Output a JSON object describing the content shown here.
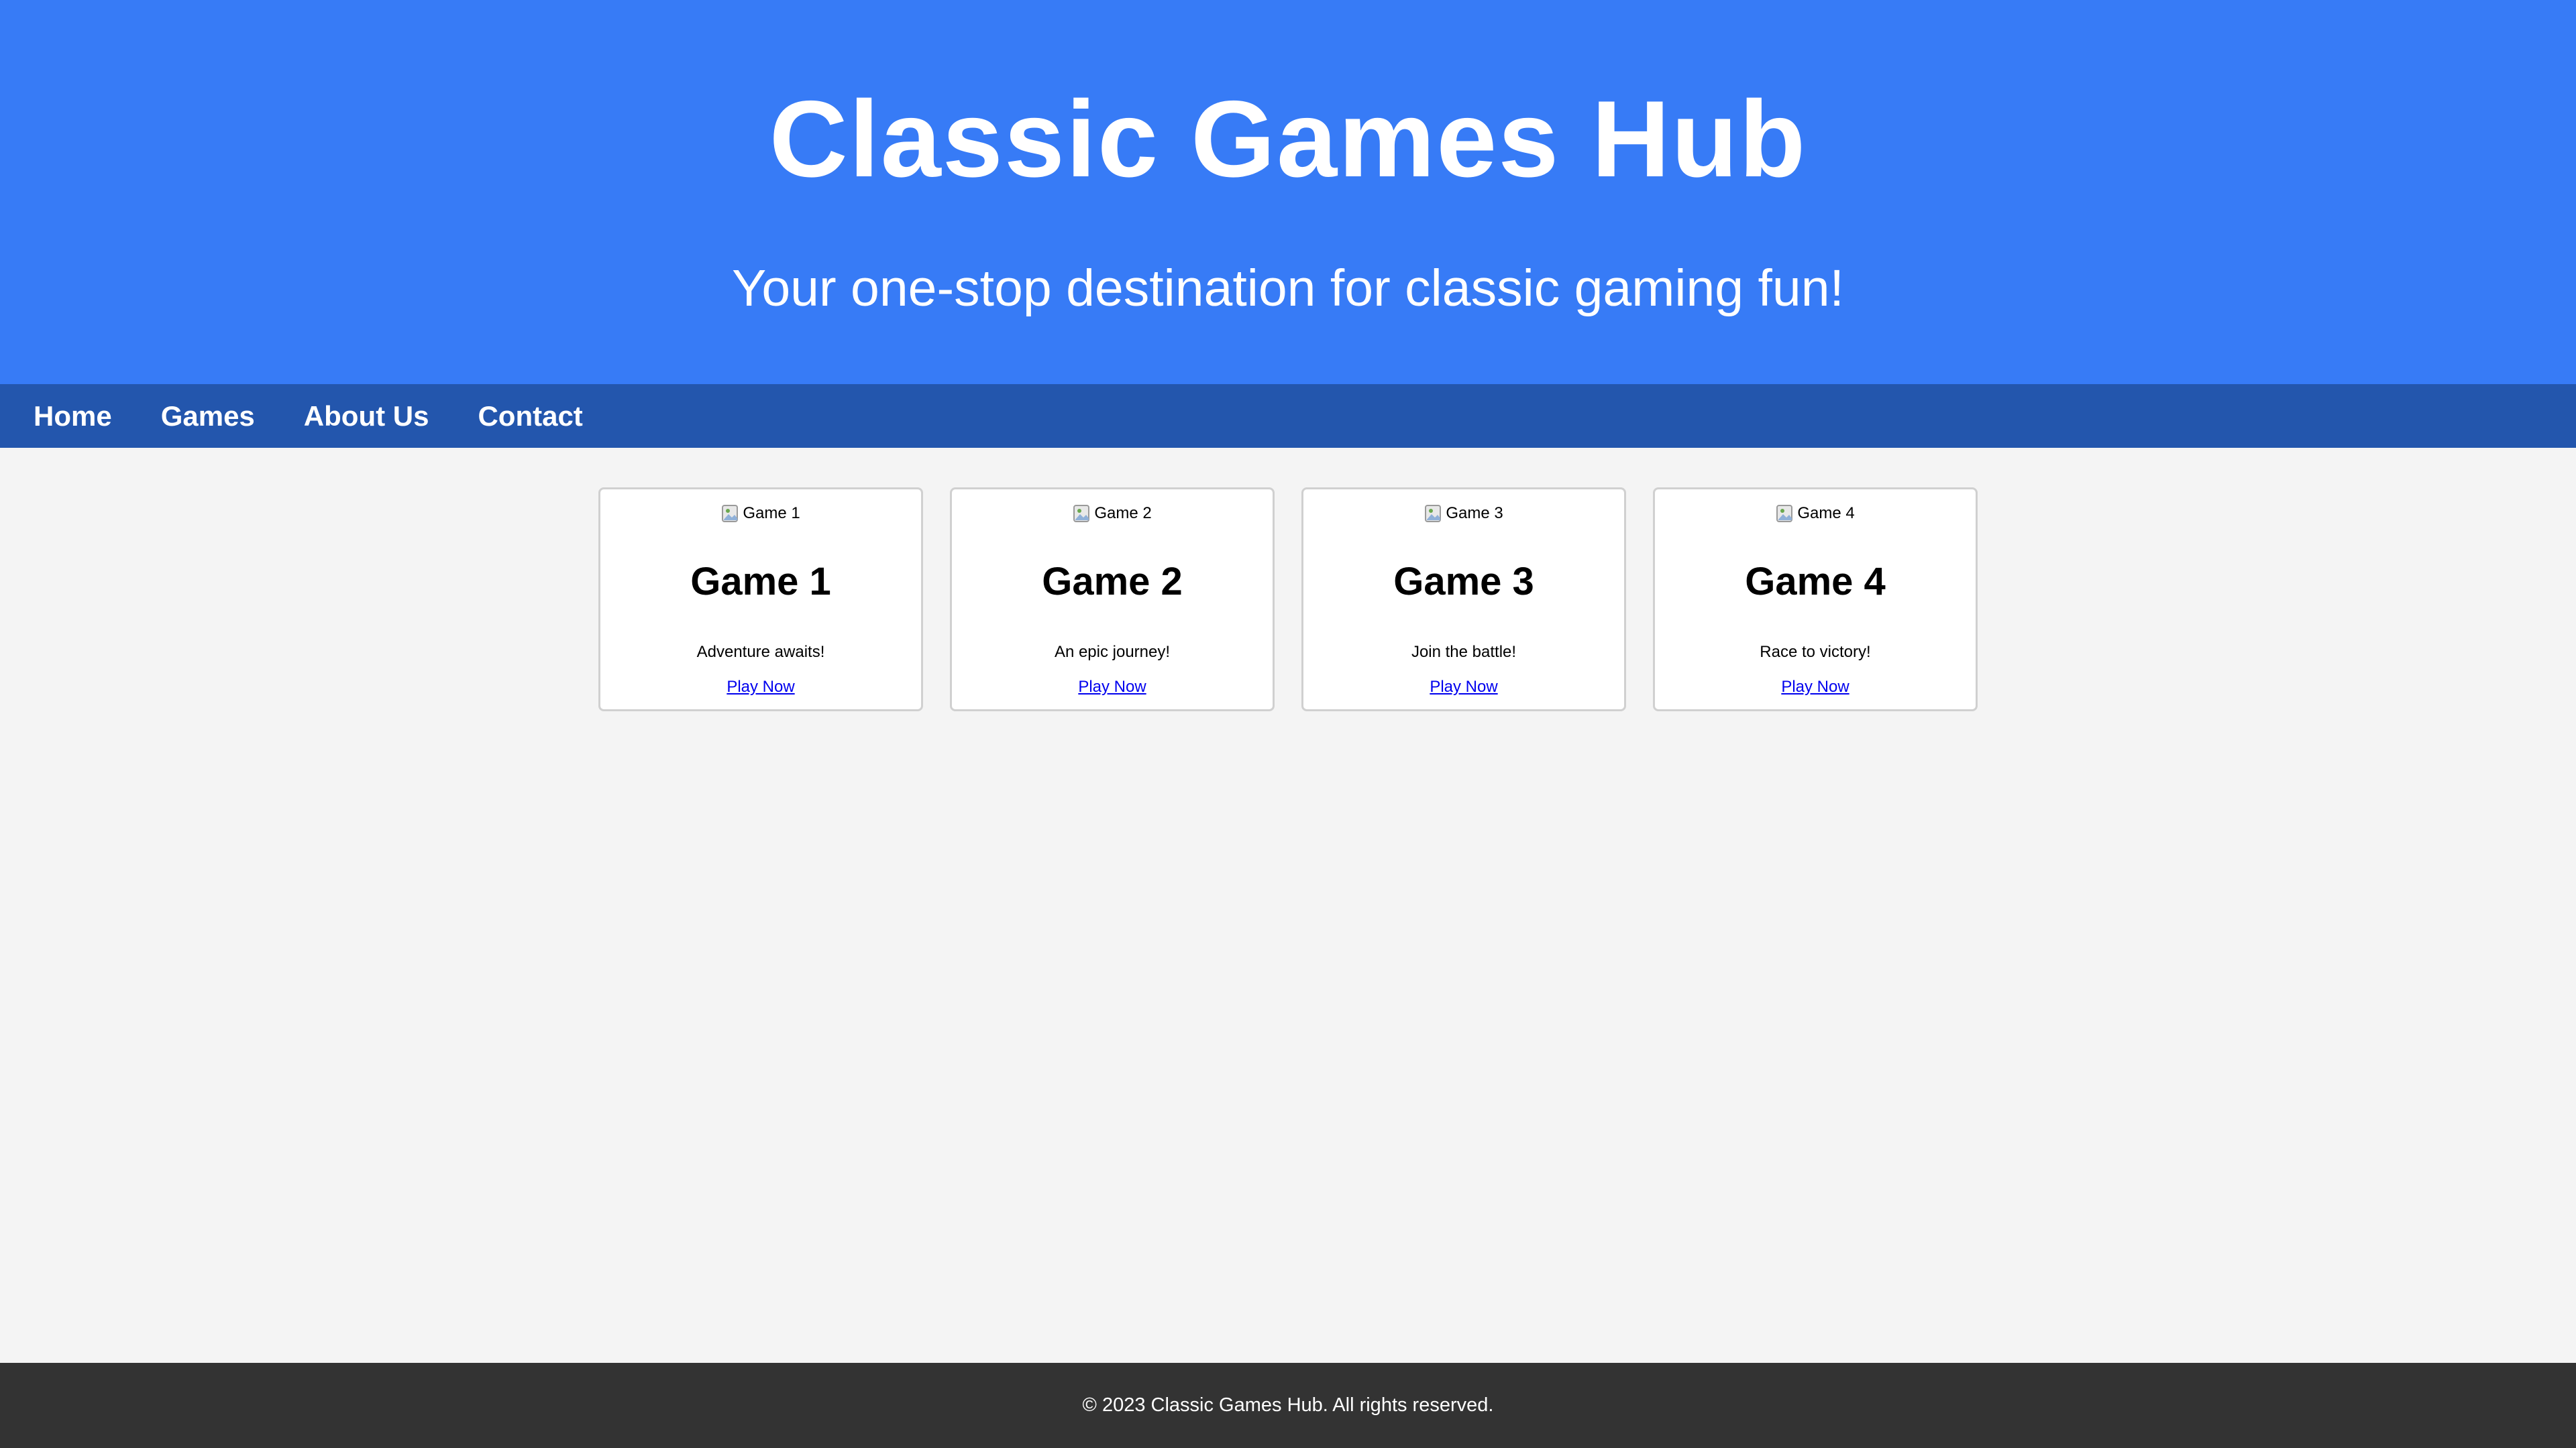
{
  "header": {
    "title": "Classic Games Hub",
    "tagline": "Your one-stop destination for classic gaming fun!"
  },
  "nav": {
    "items": [
      {
        "label": "Home"
      },
      {
        "label": "Games"
      },
      {
        "label": "About Us"
      },
      {
        "label": "Contact"
      }
    ]
  },
  "games": [
    {
      "image_alt": "Game 1",
      "image_icon": "broken-image-icon",
      "title": "Game 1",
      "description": "Adventure awaits!",
      "link_label": "Play Now"
    },
    {
      "image_alt": "Game 2",
      "image_icon": "broken-image-icon",
      "title": "Game 2",
      "description": "An epic journey!",
      "link_label": "Play Now"
    },
    {
      "image_alt": "Game 3",
      "image_icon": "broken-image-icon",
      "title": "Game 3",
      "description": "Join the battle!",
      "link_label": "Play Now"
    },
    {
      "image_alt": "Game 4",
      "image_icon": "broken-image-icon",
      "title": "Game 4",
      "description": "Race to victory!",
      "link_label": "Play Now"
    }
  ],
  "footer": {
    "copyright": "© 2023 Classic Games Hub. All rights reserved."
  },
  "colors": {
    "header_bg": "#377bf6",
    "nav_bg": "#2356ad",
    "page_bg": "#f4f4f4",
    "footer_bg": "#333333",
    "link": "#0000ee"
  }
}
